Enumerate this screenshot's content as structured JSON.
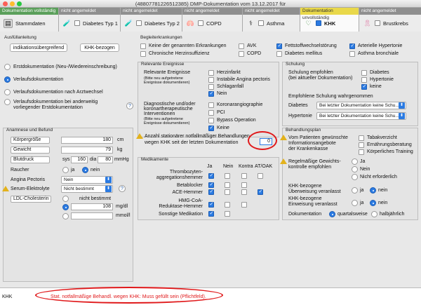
{
  "window": {
    "title": "(48807781226512385) DMP-Dokumentation vom 13.12.2017 für"
  },
  "tabs": [
    {
      "status": "Dokumentation vollständig",
      "label": "Stammdaten",
      "icon": "stammdaten-icon"
    },
    {
      "status": "nicht angemeldet",
      "label": "Diabetes Typ 1",
      "icon": "diabetes-icon"
    },
    {
      "status": "nicht angemeldet",
      "label": "Diabetes Typ 2",
      "icon": "diabetes-icon"
    },
    {
      "status": "nicht angemeldet",
      "label": "COPD",
      "icon": "lungs-icon"
    },
    {
      "status": "nicht angemeldet",
      "label": "Asthma",
      "icon": "stethoscope-icon"
    },
    {
      "status": "Dokumentation unvollständig",
      "label": "KHK",
      "icon": "heart-icon"
    },
    {
      "status": "nicht angemeldet",
      "label": "Brustkrebs",
      "icon": "ribbon-icon"
    }
  ],
  "ausfuell": {
    "title": "Ausfüllanleitung",
    "btn1": "indikationsübergreifend",
    "btn2": "KHK-bezogen"
  },
  "doku": {
    "o1": "Erstdokumentation (Neu-/Wiedereinschreibung)",
    "o2": "Verlaufsdokumentation",
    "o3": "Verlaufsdokumentation nach Arztwechsel",
    "o4a": "Verlaufsdokumentation bei anderweitig",
    "o4b": "vorliegender Erstdokumentation"
  },
  "anamnese": {
    "title": "Anamnese und Befund",
    "groesse": "Körpergröße",
    "groesse_val": "180",
    "groesse_unit": "cm",
    "gewicht": "Gewicht",
    "gewicht_val": "79",
    "gewicht_unit": "kg",
    "blutdruck": "Blutdruck",
    "sys": "sys",
    "sys_val": "160",
    "dia": "dia",
    "dia_val": "80",
    "bd_unit": "mmHg",
    "raucher": "Raucher",
    "ja": "ja",
    "nein": "nein",
    "angina": "Angina Pectoris",
    "angina_val": "Nein",
    "serum": "Serum-Elektrolyte",
    "serum_val": "Nicht bestimmt",
    "ldl": "LDL-Cholesterin",
    "nicht_best": "nicht bestimmt",
    "ldl_val": "108",
    "unit1": "mg/dl",
    "unit2": "mmol/l"
  },
  "begleit": {
    "title": "Begleiterkrankungen",
    "items": [
      "Keine der genannten Erkrankungen",
      "AVK",
      "Fettstoffwechselstörung",
      "Arterielle Hypertonie",
      "Chronische Herzinsuffizienz",
      "COPD",
      "Diabetes mellitus",
      "Asthma bronchiale"
    ]
  },
  "ereignisse": {
    "title": "Relevante Ereignisse",
    "rel": "Relevante Ereignisse",
    "rel_sub1": "(Bitte neu aufgetretene",
    "rel_sub2": "Ereignisse dokumentieren)",
    "e_items": [
      "Herzinfarkt",
      "Instabile Angina pectoris",
      "Schlaganfall",
      "Nein"
    ],
    "diag1": "Diagnostische und/oder",
    "diag2": "koronartherapeutische",
    "diag3": "Interventionen",
    "diag_sub1": "(Bitte neu aufgetretene",
    "diag_sub2": "Ereignisse dokumentieren)",
    "d_items": [
      "Koronarangiographie",
      "PCI",
      "Bypass Operation",
      "Keine"
    ],
    "anzahl1": "Anzahl stationärer notfallmäßiger Behandlungen",
    "anzahl2": "wegen KHK seit der letzten Dokumentation",
    "anzahl_val": "0"
  },
  "medikamente": {
    "title": "Medikamente",
    "cols": [
      "Ja",
      "Nein",
      "Kontra",
      "AT/OAK"
    ],
    "rows": [
      {
        "label": "Thrombozyten-",
        "label2": "aggregationshemmer"
      },
      {
        "label": "Betablocker",
        "label2": ""
      },
      {
        "label": "ACE-Hemmer",
        "label2": ""
      },
      {
        "label": "HMG-CoA-",
        "label2": "Reduktase-Hemmer"
      },
      {
        "label": "Sonstige Medikation",
        "label2": ""
      }
    ]
  },
  "schulung": {
    "title": "Schulung",
    "empf1": "Schulung empfohlen",
    "empf2": "(bei aktueller Dokumentation)",
    "items": [
      "Diabetes",
      "Hypertonie",
      "keine"
    ],
    "wahr": "Empfohlene Schulung wahrgenommen",
    "diab": "Diabetes",
    "diab_val": "Bei letzter Dokumentation keine Schu...",
    "hyp": "Hypertonie",
    "hyp_val": "Bei letzter Dokumentation keine Schu..."
  },
  "plan": {
    "title": "Behandlungsplan",
    "angebot1": "Vom Patienten gewünschte",
    "angebot2": "Informationsangebote",
    "angebot3": "der Krankenkasse",
    "a_items": [
      "Tabakverzicht",
      "Ernährungsberatung",
      "Körperliches Training"
    ],
    "gewicht1": "Regelmäßige Gewichts-",
    "gewicht2": "kontrolle empfohlen",
    "g_items": [
      "Ja",
      "Nein",
      "Nicht erforderlich"
    ],
    "ueber1": "KHK-bezogene",
    "ueber2": "Überweisung veranlasst",
    "ein1": "KHK-bezogene",
    "ein2": "Einweisung veranlasst",
    "ja": "ja",
    "nein": "nein",
    "dok": "Dokumentation",
    "q": "quartalsweise",
    "h": "halbjährlich"
  },
  "status": {
    "left": "KHK",
    "message": "Stat. notfallmäßige Behandl. wegen KHK: Muss gefüllt sein (Pflichtfeld)."
  },
  "colors": {
    "green": "#5a9f5a",
    "yellow": "#e9d84a",
    "accent": "#2a7ae2",
    "warn": "#e0191b"
  }
}
